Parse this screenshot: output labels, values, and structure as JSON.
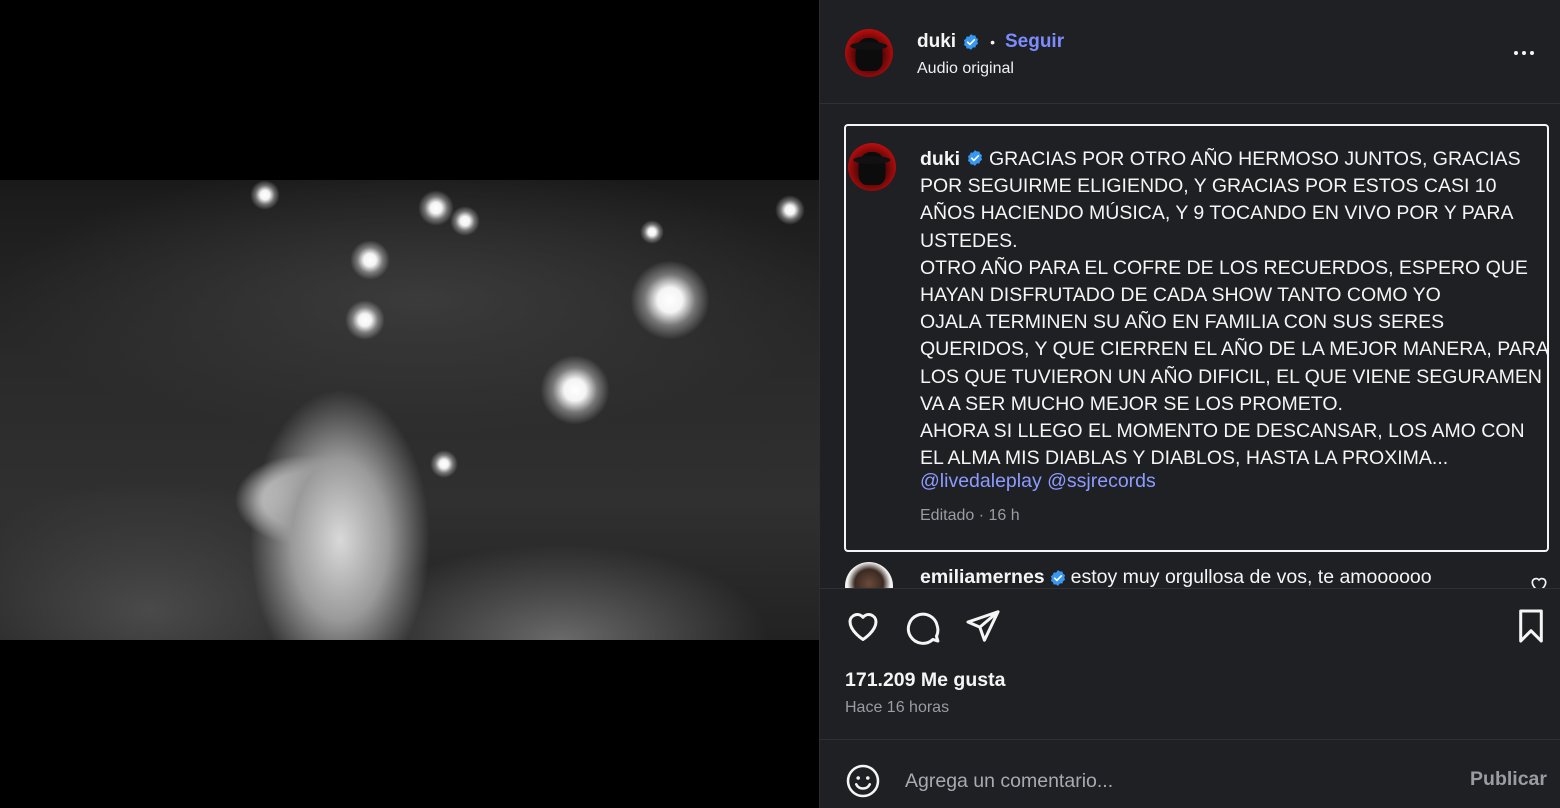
{
  "post": {
    "username": "duki",
    "dot": "•",
    "follow_label": "Seguir",
    "audio_label": "Audio original"
  },
  "caption": {
    "username": "duki",
    "text": "GRACIAS POR OTRO AÑO HERMOSO JUNTOS, GRACIAS POR SEGUIRME ELIGIENDO, Y GRACIAS POR ESTOS CASI 10 AÑOS HACIENDO MÚSICA, Y 9 TOCANDO EN VIVO POR Y PARA USTEDES.\nOTRO AÑO PARA EL COFRE DE LOS RECUERDOS, ESPERO QUE HAYAN DISFRUTADO DE CADA SHOW TANTO COMO YO\nOJALA TERMINEN SU AÑO EN FAMILIA CON SUS SERES QUERIDOS, Y QUE CIERREN EL AÑO DE LA MEJOR MANERA, PARA LOS QUE TUVIERON UN AÑO DIFICIL, EL QUE VIENE SEGURAMEN VA A SER MUCHO MEJOR SE LOS PROMETO.\nAHORA SI LLEGO EL MOMENTO DE DESCANSAR, LOS AMO CON EL ALMA MIS DIABLAS Y DIABLOS, HASTA LA PROXIMA...",
    "mention_1": "@livedaleplay",
    "mention_2": "@ssjrecords",
    "meta": "Editado · 16 h"
  },
  "comment": {
    "username": "emiliamernes",
    "text": "estoy muy orgullosa de vos, te amoooooo"
  },
  "stats": {
    "likes": "171.209 Me gusta",
    "time_ago": "Hace 16 horas"
  },
  "composer": {
    "placeholder": "Agrega un comentario...",
    "publish_label": "Publicar"
  },
  "icons": {
    "verified": "verified-badge-icon",
    "mute": "muted-speaker-icon",
    "like": "heart-icon",
    "comment": "comment-bubble-icon",
    "share": "paper-plane-icon",
    "save": "bookmark-icon",
    "emoji": "emoji-smiley-icon",
    "more": "more-options-icon"
  },
  "colors": {
    "panel_bg": "#1f2024",
    "link": "#8c9bff",
    "follow": "#7c8cff",
    "verified": "#3897f0",
    "muted_text": "#9a9ca3"
  }
}
